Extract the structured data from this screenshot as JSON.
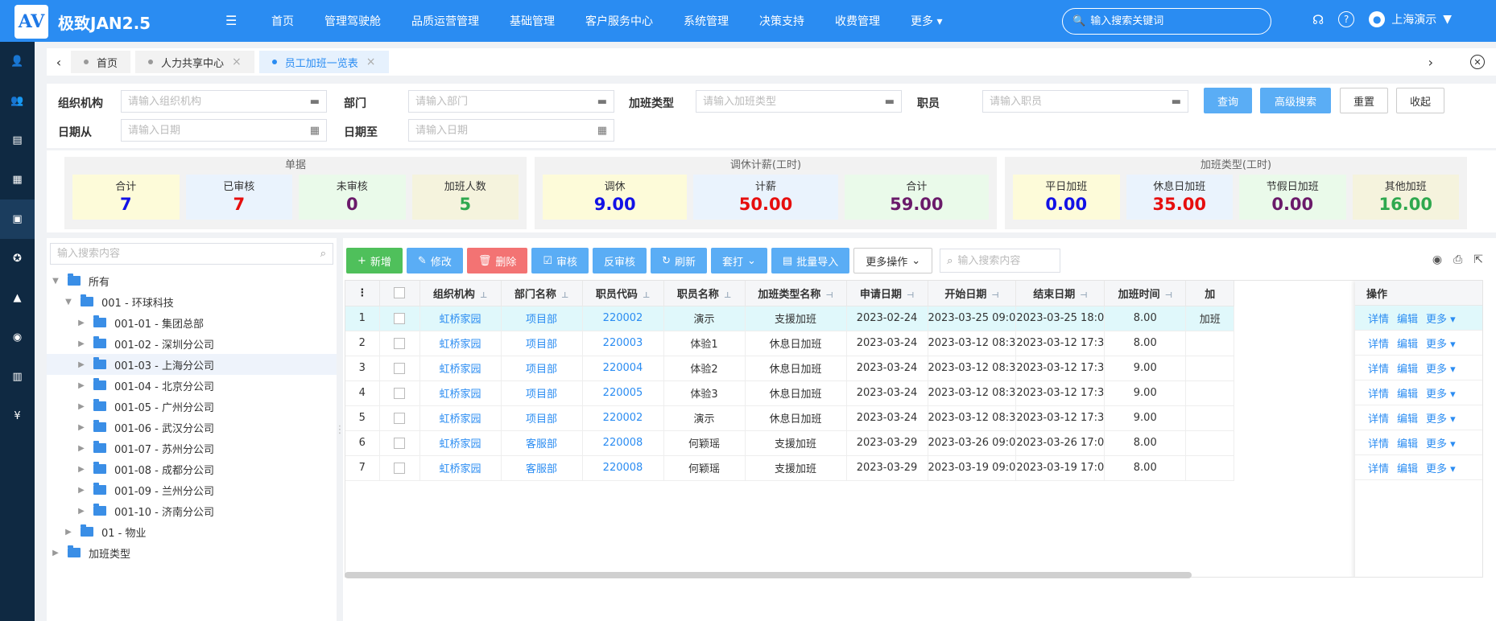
{
  "app": {
    "logo_text": "AV",
    "title": "极致JAN2.5"
  },
  "top_nav": {
    "items": [
      "首页",
      "管理驾驶舱",
      "品质运营管理",
      "基础管理",
      "客户服务中心",
      "系统管理",
      "决策支持",
      "收费管理",
      "更多"
    ],
    "search_placeholder": "输入搜索关键词",
    "user": "上海演示"
  },
  "sidebar": {
    "icons": [
      "user-icon",
      "group-icon",
      "document-icon",
      "report-icon",
      "calendar-icon",
      "medal-icon",
      "graduation-icon",
      "eye-icon",
      "building-icon",
      "money-bag-icon"
    ],
    "active_index": 4
  },
  "tabs": [
    {
      "label": "首页",
      "closable": false
    },
    {
      "label": "人力共享中心",
      "closable": true
    },
    {
      "label": "员工加班一览表",
      "closable": true,
      "active": true
    }
  ],
  "filters": {
    "org_label": "组织机构",
    "org_placeholder": "请输入组织机构",
    "dept_label": "部门",
    "dept_placeholder": "请输入部门",
    "ot_type_label": "加班类型",
    "ot_type_placeholder": "请输入加班类型",
    "employee_label": "职员",
    "employee_placeholder": "请输入职员",
    "date_from_label": "日期从",
    "date_from_placeholder": "请输入日期",
    "date_to_label": "日期至",
    "date_to_placeholder": "请输入日期",
    "query_btn": "查询",
    "advanced_btn": "高级搜索",
    "reset_btn": "重置",
    "collapse_btn": "收起"
  },
  "stats": {
    "doc": {
      "title": "单据",
      "cards": [
        {
          "label": "合计",
          "value": "7",
          "color": "#1212e6",
          "bg": "#fdfbd9"
        },
        {
          "label": "已审核",
          "value": "7",
          "color": "#e60e0e",
          "bg": "#eaf3fd"
        },
        {
          "label": "未审核",
          "value": "0",
          "color": "#6a1a6a",
          "bg": "#eafaea"
        },
        {
          "label": "加班人数",
          "value": "5",
          "color": "#2fa84f",
          "bg": "#f5f3dd"
        }
      ]
    },
    "rest": {
      "title": "调休计薪(工时)",
      "cards": [
        {
          "label": "调休",
          "value": "9.00",
          "color": "#1212e6",
          "bg": "#fdfbd9"
        },
        {
          "label": "计薪",
          "value": "50.00",
          "color": "#e60e0e",
          "bg": "#eaf3fd"
        },
        {
          "label": "合计",
          "value": "59.00",
          "color": "#6a1a6a",
          "bg": "#eafaea"
        }
      ]
    },
    "type": {
      "title": "加班类型(工时)",
      "cards": [
        {
          "label": "平日加班",
          "value": "0.00",
          "color": "#1212e6",
          "bg": "#fdfbd9"
        },
        {
          "label": "休息日加班",
          "value": "35.00",
          "color": "#e60e0e",
          "bg": "#eaf3fd"
        },
        {
          "label": "节假日加班",
          "value": "0.00",
          "color": "#6a1a6a",
          "bg": "#eafaea"
        },
        {
          "label": "其他加班",
          "value": "16.00",
          "color": "#2fa84f",
          "bg": "#f5f3dd"
        }
      ]
    }
  },
  "tree": {
    "search_placeholder": "输入搜索内容",
    "nodes": [
      {
        "label": "所有",
        "level": 0,
        "arrow": "down",
        "folder": true
      },
      {
        "label": "001 - 环球科技",
        "level": 1,
        "arrow": "down",
        "folder": true
      },
      {
        "label": "001-01 - 集团总部",
        "level": 2,
        "arrow": "right",
        "folder": true
      },
      {
        "label": "001-02 - 深圳分公司",
        "level": 2,
        "arrow": "right",
        "folder": true
      },
      {
        "label": "001-03 - 上海分公司",
        "level": 2,
        "arrow": "right",
        "folder": true,
        "selected": true
      },
      {
        "label": "001-04 - 北京分公司",
        "level": 2,
        "arrow": "right",
        "folder": true
      },
      {
        "label": "001-05 - 广州分公司",
        "level": 2,
        "arrow": "right",
        "folder": true
      },
      {
        "label": "001-06 - 武汉分公司",
        "level": 2,
        "arrow": "right",
        "folder": true
      },
      {
        "label": "001-07 - 苏州分公司",
        "level": 2,
        "arrow": "right",
        "folder": true
      },
      {
        "label": "001-08 - 成都分公司",
        "level": 2,
        "arrow": "right",
        "folder": true
      },
      {
        "label": "001-09 - 兰州分公司",
        "level": 2,
        "arrow": "right",
        "folder": true
      },
      {
        "label": "001-10 - 济南分公司",
        "level": 2,
        "arrow": "right",
        "folder": true
      },
      {
        "label": "01 - 物业",
        "level": 1,
        "arrow": "right",
        "folder": true
      },
      {
        "label": "加班类型",
        "level": 0,
        "arrow": "right",
        "folder": true
      }
    ]
  },
  "toolbar": {
    "buttons": [
      {
        "label": "新增",
        "style": "green",
        "icon": "plus-icon",
        "glyph": "+"
      },
      {
        "label": "修改",
        "style": "blue",
        "icon": "edit-icon",
        "glyph": "✎"
      },
      {
        "label": "删除",
        "style": "red",
        "icon": "trash-icon",
        "glyph": "🗑"
      },
      {
        "label": "审核",
        "style": "blue",
        "icon": "clipboard-icon",
        "glyph": "☑"
      },
      {
        "label": "反审核",
        "style": "blue",
        "icon": "",
        "glyph": ""
      },
      {
        "label": "刷新",
        "style": "blue",
        "icon": "refresh-icon",
        "glyph": "↻"
      },
      {
        "label": "套打",
        "style": "blue",
        "icon": "chevron-down-icon",
        "glyph": "⌄",
        "suffix": true
      },
      {
        "label": "批量导入",
        "style": "blue",
        "icon": "import-icon",
        "glyph": "▤"
      },
      {
        "label": "更多操作",
        "style": "outline",
        "icon": "chevron-down-icon",
        "glyph": "⌄",
        "suffix": true
      }
    ],
    "search_placeholder": "输入搜索内容"
  },
  "table": {
    "columns": [
      "组织机构",
      "部门名称",
      "职员代码",
      "职员名称",
      "加班类型名称",
      "申请日期",
      "开始日期",
      "结束日期",
      "加班时间",
      "加"
    ],
    "ops_header": "操作",
    "ops": [
      "详情",
      "编辑",
      "更多"
    ],
    "rows": [
      {
        "no": "1",
        "org": "虹桥家园",
        "dept": "项目部",
        "code": "220002",
        "name": "演示",
        "type": "支援加班",
        "apply": "2023-02-24",
        "start": "2023-03-25 09:0",
        "end": "2023-03-25 18:0",
        "hours": "8.00",
        "extra": "加班"
      },
      {
        "no": "2",
        "org": "虹桥家园",
        "dept": "项目部",
        "code": "220003",
        "name": "体验1",
        "type": "休息日加班",
        "apply": "2023-03-24",
        "start": "2023-03-12 08:3",
        "end": "2023-03-12 17:3",
        "hours": "8.00",
        "extra": ""
      },
      {
        "no": "3",
        "org": "虹桥家园",
        "dept": "项目部",
        "code": "220004",
        "name": "体验2",
        "type": "休息日加班",
        "apply": "2023-03-24",
        "start": "2023-03-12 08:3",
        "end": "2023-03-12 17:3",
        "hours": "9.00",
        "extra": ""
      },
      {
        "no": "4",
        "org": "虹桥家园",
        "dept": "项目部",
        "code": "220005",
        "name": "体验3",
        "type": "休息日加班",
        "apply": "2023-03-24",
        "start": "2023-03-12 08:3",
        "end": "2023-03-12 17:3",
        "hours": "9.00",
        "extra": ""
      },
      {
        "no": "5",
        "org": "虹桥家园",
        "dept": "项目部",
        "code": "220002",
        "name": "演示",
        "type": "休息日加班",
        "apply": "2023-03-24",
        "start": "2023-03-12 08:3",
        "end": "2023-03-12 17:3",
        "hours": "9.00",
        "extra": ""
      },
      {
        "no": "6",
        "org": "虹桥家园",
        "dept": "客服部",
        "code": "220008",
        "name": "何颖瑶",
        "type": "支援加班",
        "apply": "2023-03-29",
        "start": "2023-03-26 09:0",
        "end": "2023-03-26 17:0",
        "hours": "8.00",
        "extra": ""
      },
      {
        "no": "7",
        "org": "虹桥家园",
        "dept": "客服部",
        "code": "220008",
        "name": "何颖瑶",
        "type": "支援加班",
        "apply": "2023-03-29",
        "start": "2023-03-19 09:0",
        "end": "2023-03-19 17:0",
        "hours": "8.00",
        "extra": ""
      }
    ]
  }
}
